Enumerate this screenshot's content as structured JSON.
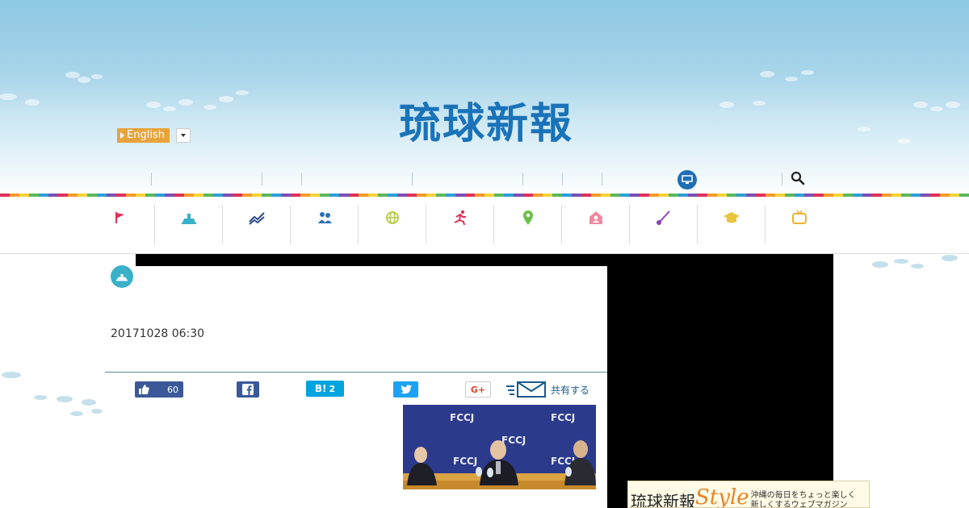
{
  "header": {
    "logo_text": "琉球新報",
    "lang_label": "English"
  },
  "categories": [
    {
      "name": "flag",
      "color": "#e0305a"
    },
    {
      "name": "government",
      "color": "#3ab0c9"
    },
    {
      "name": "economy",
      "color": "#2b4a8a"
    },
    {
      "name": "people",
      "color": "#2b6fb5"
    },
    {
      "name": "world",
      "color": "#b6c93a"
    },
    {
      "name": "sports",
      "color": "#e0305a"
    },
    {
      "name": "local",
      "color": "#6cc04a"
    },
    {
      "name": "life",
      "color": "#f08aa0"
    },
    {
      "name": "culture",
      "color": "#8a44b8"
    },
    {
      "name": "education",
      "color": "#e8c43a"
    },
    {
      "name": "tv",
      "color": "#f0b030"
    }
  ],
  "article": {
    "date": "20171028 06:30"
  },
  "share": {
    "like_count": "60",
    "hatena_label": "B!",
    "hatena_count": "2",
    "gplus_label": "G+",
    "share_label": "共有する"
  },
  "photo": {
    "backdrop_text": "FCCJ"
  },
  "banner": {
    "logo": "琉球新報",
    "style_word": "Style",
    "tagline_1": "沖縄の毎日をちょっと楽しく",
    "tagline_2": "新しくするウェブマガジン"
  },
  "colors": {
    "brand_blue": "#1a73b8",
    "lang_orange": "#e8a33d",
    "facebook": "#3b5998",
    "twitter": "#1da1f2",
    "hatena": "#00a4de"
  }
}
